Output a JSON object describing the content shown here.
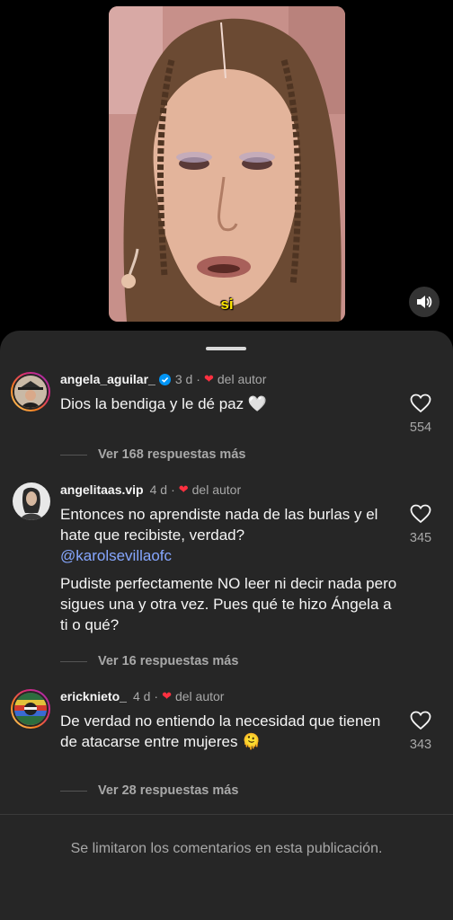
{
  "video": {
    "caption": "si"
  },
  "comments": [
    {
      "username": "angela_aguilar_",
      "verified": true,
      "time": "3 d",
      "author_label": "del autor",
      "text": "Dios la bendiga y le dé paz 🤍",
      "likes": "554",
      "replies_label": "Ver 168 respuestas más"
    },
    {
      "username": "angelitaas.vip",
      "verified": false,
      "time": "4 d",
      "author_label": "del autor",
      "text_line1": "Entonces no aprendiste nada de las burlas y el hate que recibiste, verdad?",
      "mention": "@karolsevillaofc",
      "text_line2": "Pudiste perfectamente NO leer ni decir nada pero sigues una y otra vez. Pues qué te hizo Ángela a ti o qué?",
      "likes": "345",
      "replies_label": "Ver 16 respuestas más"
    },
    {
      "username": "ericknieto_",
      "verified": false,
      "time": "4 d",
      "author_label": "del autor",
      "text": "De verdad no entiendo la necesidad que tienen de atacarse entre mujeres 🫠",
      "likes": "343",
      "replies_label": "Ver 28 respuestas más"
    }
  ],
  "footer": {
    "limited_notice": "Se limitaron los comentarios en esta publicación."
  },
  "colors": {
    "sheet_bg": "#262626",
    "like_red": "#ff3040",
    "mention_blue": "#86a7ff",
    "verified_blue": "#0095f6",
    "caption_yellow": "#ffe600"
  }
}
